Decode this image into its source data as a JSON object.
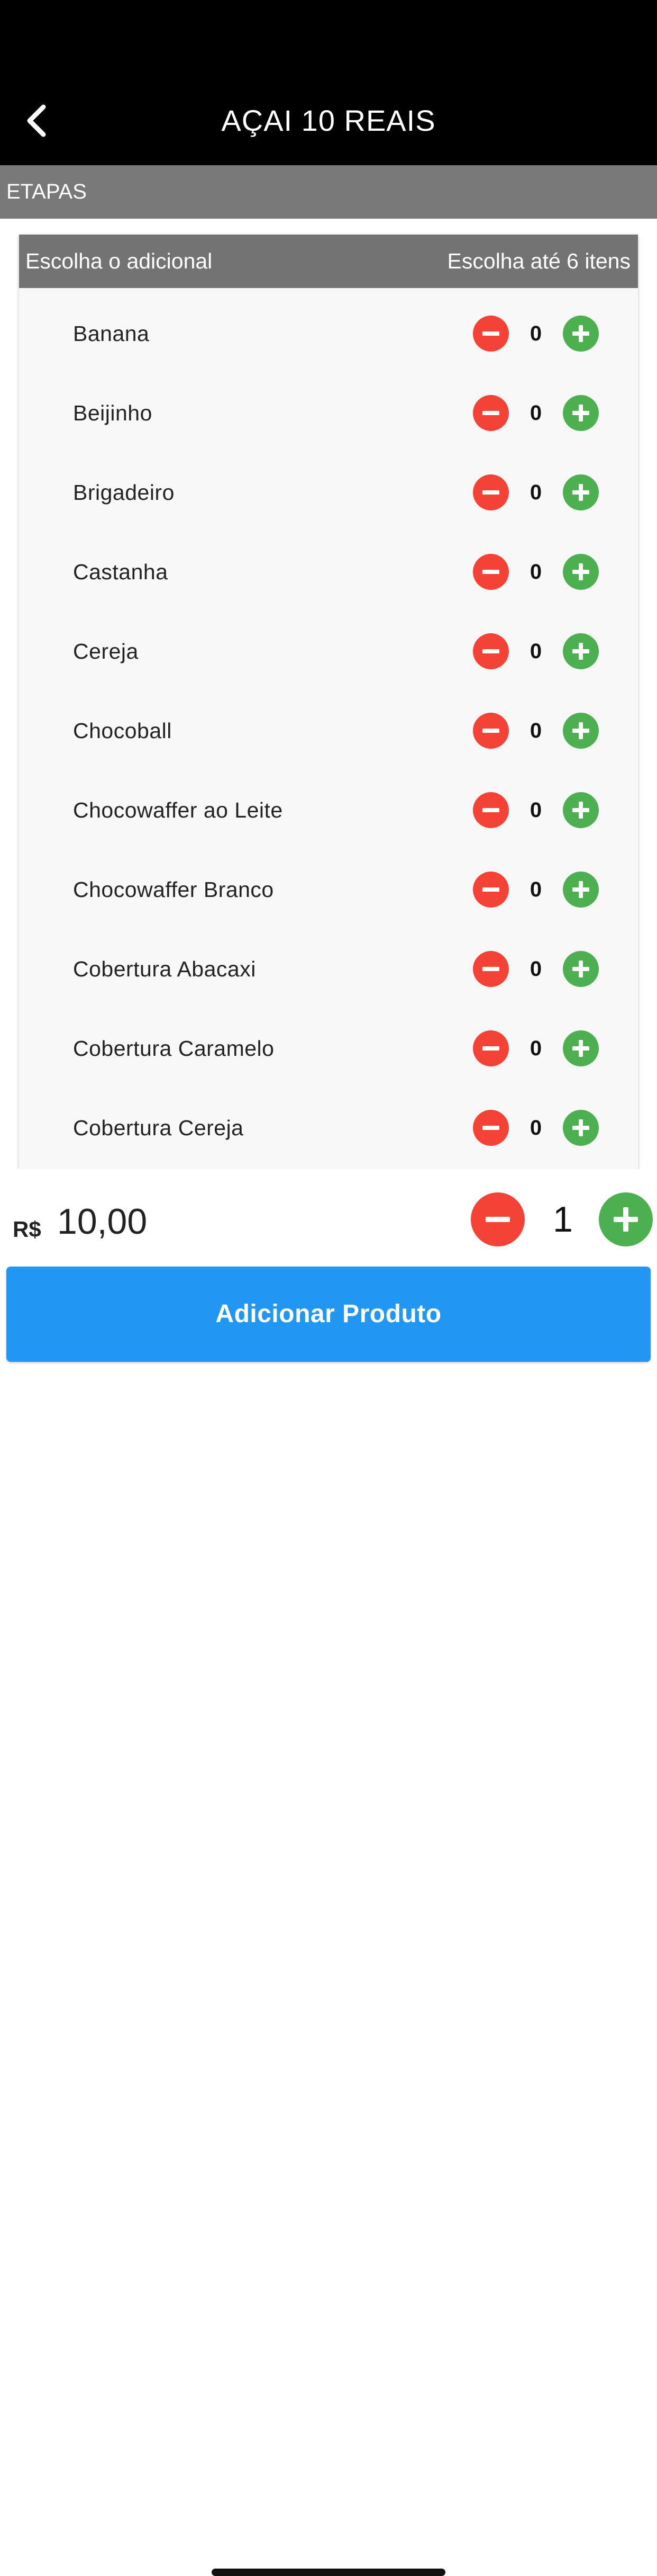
{
  "header": {
    "title": "AÇAI 10 REAIS",
    "back_icon": "chevron-left-icon"
  },
  "steps_bar": {
    "label": "ETAPAS"
  },
  "addons": {
    "title": "Escolha o adicional",
    "limit_text": "Escolha até 6 itens",
    "items": [
      {
        "name": "Banana",
        "count": "0"
      },
      {
        "name": "Beijinho",
        "count": "0"
      },
      {
        "name": "Brigadeiro",
        "count": "0"
      },
      {
        "name": "Castanha",
        "count": "0"
      },
      {
        "name": "Cereja",
        "count": "0"
      },
      {
        "name": "Chocoball",
        "count": "0"
      },
      {
        "name": "Chocowaffer ao Leite",
        "count": "0"
      },
      {
        "name": "Chocowaffer Branco",
        "count": "0"
      },
      {
        "name": "Cobertura Abacaxi",
        "count": "0"
      },
      {
        "name": "Cobertura Caramelo",
        "count": "0"
      },
      {
        "name": "Cobertura Cereja",
        "count": "0"
      }
    ]
  },
  "footer": {
    "currency": "R$",
    "price": "10,00",
    "quantity": "1",
    "add_button_label": "Adicionar Produto"
  },
  "colors": {
    "header_bg": "#000000",
    "steps_bar_bg": "#797979",
    "card_header_bg": "#737373",
    "minus": "#f44336",
    "plus": "#4caf50",
    "primary_button": "#2196f3"
  }
}
